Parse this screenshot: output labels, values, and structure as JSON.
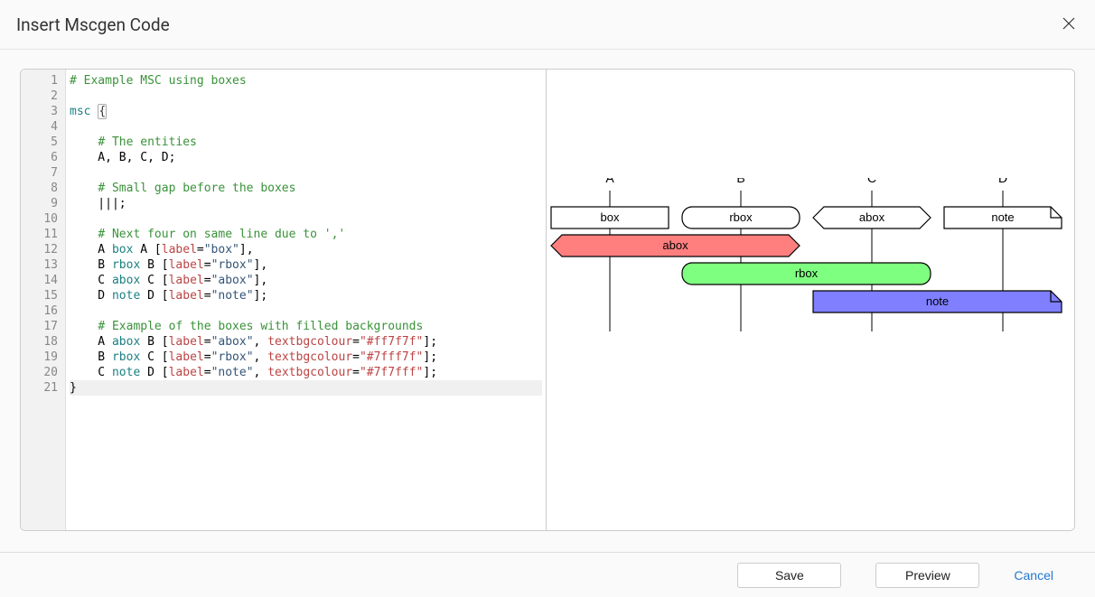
{
  "header": {
    "title": "Insert Mscgen Code"
  },
  "close_tooltip": "Close",
  "editor": {
    "line_count": 21,
    "current_line": 21,
    "lines": [
      {
        "segments": [
          {
            "t": "# Example MSC using boxes",
            "c": "c-comment"
          }
        ]
      },
      {
        "segments": []
      },
      {
        "segments": [
          {
            "t": "msc",
            "c": "c-kw"
          },
          {
            "t": " "
          },
          {
            "t": "{",
            "c": "c-brace"
          }
        ]
      },
      {
        "segments": []
      },
      {
        "segments": [
          {
            "t": "    "
          },
          {
            "t": "# The entities",
            "c": "c-comment"
          }
        ]
      },
      {
        "segments": [
          {
            "t": "    A, B, C, D;"
          }
        ]
      },
      {
        "segments": []
      },
      {
        "segments": [
          {
            "t": "    "
          },
          {
            "t": "# Small gap before the boxes",
            "c": "c-comment"
          }
        ]
      },
      {
        "segments": [
          {
            "t": "    |||;"
          }
        ]
      },
      {
        "segments": []
      },
      {
        "segments": [
          {
            "t": "    "
          },
          {
            "t": "# Next four on same line due to ','",
            "c": "c-comment"
          }
        ]
      },
      {
        "segments": [
          {
            "t": "    A "
          },
          {
            "t": "box",
            "c": "c-kw"
          },
          {
            "t": " A ["
          },
          {
            "t": "label",
            "c": "c-attr"
          },
          {
            "t": "="
          },
          {
            "t": "\"box\"",
            "c": "c-string"
          },
          {
            "t": "],"
          }
        ]
      },
      {
        "segments": [
          {
            "t": "    B "
          },
          {
            "t": "rbox",
            "c": "c-kw"
          },
          {
            "t": " B ["
          },
          {
            "t": "label",
            "c": "c-attr"
          },
          {
            "t": "="
          },
          {
            "t": "\"rbox\"",
            "c": "c-string"
          },
          {
            "t": "],"
          }
        ]
      },
      {
        "segments": [
          {
            "t": "    C "
          },
          {
            "t": "abox",
            "c": "c-kw"
          },
          {
            "t": " C ["
          },
          {
            "t": "label",
            "c": "c-attr"
          },
          {
            "t": "="
          },
          {
            "t": "\"abox\"",
            "c": "c-string"
          },
          {
            "t": "],"
          }
        ]
      },
      {
        "segments": [
          {
            "t": "    D "
          },
          {
            "t": "note",
            "c": "c-kw"
          },
          {
            "t": " D ["
          },
          {
            "t": "label",
            "c": "c-attr"
          },
          {
            "t": "="
          },
          {
            "t": "\"note\"",
            "c": "c-string"
          },
          {
            "t": "];"
          }
        ]
      },
      {
        "segments": []
      },
      {
        "segments": [
          {
            "t": "    "
          },
          {
            "t": "# Example of the boxes with filled backgrounds",
            "c": "c-comment"
          }
        ]
      },
      {
        "segments": [
          {
            "t": "    A "
          },
          {
            "t": "abox",
            "c": "c-kw"
          },
          {
            "t": " B ["
          },
          {
            "t": "label",
            "c": "c-attr"
          },
          {
            "t": "="
          },
          {
            "t": "\"abox\"",
            "c": "c-string"
          },
          {
            "t": ", "
          },
          {
            "t": "textbgcolour",
            "c": "c-attr"
          },
          {
            "t": "="
          },
          {
            "t": "\"#ff7f7f\"",
            "c": "c-string2"
          },
          {
            "t": "];"
          }
        ]
      },
      {
        "segments": [
          {
            "t": "    B "
          },
          {
            "t": "rbox",
            "c": "c-kw"
          },
          {
            "t": " C ["
          },
          {
            "t": "label",
            "c": "c-attr"
          },
          {
            "t": "="
          },
          {
            "t": "\"rbox\"",
            "c": "c-string"
          },
          {
            "t": ", "
          },
          {
            "t": "textbgcolour",
            "c": "c-attr"
          },
          {
            "t": "="
          },
          {
            "t": "\"#7fff7f\"",
            "c": "c-string2"
          },
          {
            "t": "];"
          }
        ]
      },
      {
        "segments": [
          {
            "t": "    C "
          },
          {
            "t": "note",
            "c": "c-kw"
          },
          {
            "t": " D ["
          },
          {
            "t": "label",
            "c": "c-attr"
          },
          {
            "t": "="
          },
          {
            "t": "\"note\"",
            "c": "c-string"
          },
          {
            "t": ", "
          },
          {
            "t": "textbgcolour",
            "c": "c-attr"
          },
          {
            "t": "="
          },
          {
            "t": "\"#7f7fff\"",
            "c": "c-string2"
          },
          {
            "t": "];"
          }
        ]
      },
      {
        "segments": [
          {
            "t": "}"
          }
        ]
      }
    ]
  },
  "preview": {
    "entities": [
      "A",
      "B",
      "C",
      "D"
    ],
    "row1": [
      {
        "shape": "box",
        "label": "box"
      },
      {
        "shape": "rbox",
        "label": "rbox"
      },
      {
        "shape": "abox",
        "label": "abox"
      },
      {
        "shape": "note",
        "label": "note"
      }
    ],
    "row2": {
      "from": 0,
      "to": 1,
      "shape": "abox",
      "label": "abox",
      "fill": "#ff7f7f"
    },
    "row3": {
      "from": 1,
      "to": 2,
      "shape": "rbox",
      "label": "rbox",
      "fill": "#7fff7f"
    },
    "row4": {
      "from": 2,
      "to": 3,
      "shape": "note",
      "label": "note",
      "fill": "#7f7fff"
    }
  },
  "footer": {
    "save": "Save",
    "preview": "Preview",
    "cancel": "Cancel"
  }
}
